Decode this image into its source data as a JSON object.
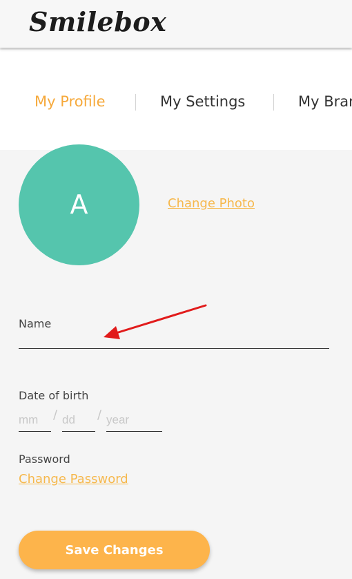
{
  "header": {
    "logo_text": "Smilebox"
  },
  "tabs": [
    {
      "label": "My Profile",
      "active": true
    },
    {
      "label": "My Settings",
      "active": false
    },
    {
      "label": "My Brand",
      "active": false
    }
  ],
  "profile": {
    "avatar_initial": "A",
    "avatar_color": "#55c5ad",
    "change_photo_label": "Change Photo"
  },
  "form": {
    "name_label": "Name",
    "name_value": "",
    "dob_label": "Date of birth",
    "dob_month_placeholder": "mm",
    "dob_day_placeholder": "dd",
    "dob_year_placeholder": "year",
    "dob_separator": "/",
    "password_label": "Password",
    "change_password_label": "Change Password",
    "save_label": "Save Changes"
  },
  "colors": {
    "accent": "#f6a93b",
    "link": "#f6b84c",
    "button": "#fdb44b",
    "annotation_arrow": "#e11b1b"
  }
}
